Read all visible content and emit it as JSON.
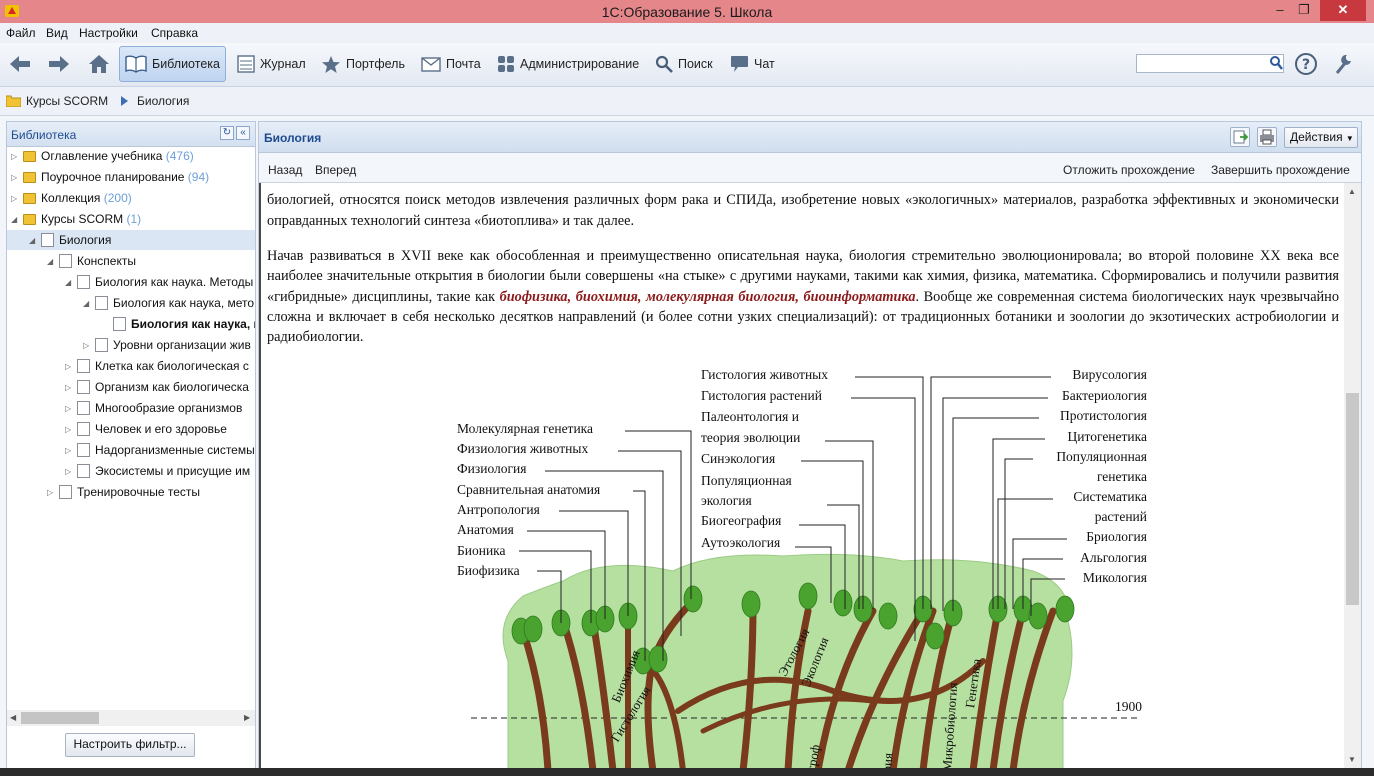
{
  "window": {
    "title": "1С:Образование 5. Школа"
  },
  "menu": [
    "Файл",
    "Вид",
    "Настройки",
    "Справка"
  ],
  "toolbar": {
    "library": "Библиотека",
    "journal": "Журнал",
    "portfolio": "Портфель",
    "mail": "Почта",
    "admin": "Администрирование",
    "search": "Поиск",
    "chat": "Чат",
    "search_value": ""
  },
  "breadcrumb": {
    "root": "Курсы SCORM",
    "current": "Биология"
  },
  "library_panel": {
    "title": "Библиотека",
    "tree": [
      {
        "label": "Оглавление учебника",
        "count": "(476)"
      },
      {
        "label": "Поурочное планирование",
        "count": "(94)"
      },
      {
        "label": "Коллекция",
        "count": "(200)"
      },
      {
        "label": "Курсы SCORM",
        "count": "(1)"
      },
      {
        "label": "Биология",
        "count": ""
      },
      {
        "label": "Конспекты",
        "count": ""
      },
      {
        "label": "Биология как наука. Методы",
        "count": ""
      },
      {
        "label": "Биология как наука, мето",
        "count": ""
      },
      {
        "label": "Биология как наука, м",
        "count": ""
      },
      {
        "label": "Уровни организации жив",
        "count": ""
      },
      {
        "label": "Клетка как биологическая с",
        "count": ""
      },
      {
        "label": "Организм как биологическа",
        "count": ""
      },
      {
        "label": "Многообразие организмов",
        "count": ""
      },
      {
        "label": "Человек и его здоровье",
        "count": ""
      },
      {
        "label": "Надорганизменные системы",
        "count": ""
      },
      {
        "label": "Экосистемы и присущие им",
        "count": ""
      },
      {
        "label": "Тренировочные тесты",
        "count": ""
      }
    ],
    "filter_button": "Настроить фильтр..."
  },
  "content_panel": {
    "title": "Биология",
    "actions": "Действия",
    "nav_back": "Назад",
    "nav_forward": "Вперед",
    "postpone": "Отложить прохождение",
    "finish": "Завершить прохождение"
  },
  "article": {
    "p1_line2": "биологией, относятся поиск методов извлечения различных форм рака и СПИДа, изобретение новых «экологичных» материалов, разработка эффективных и экономически оправданных технологий синтеза «биотоплива» и так далее.",
    "p2_a": "Начав развиваться в XVII веке как обособленная и преимущественно описательная наука, биология стремительно эволюционировала; во второй половине XX века все наиболее значительные открытия в биологии были совершены «на стыке» с другими науками, такими как химия, физика, математика. Сформировались и получили развития «гибридные» дисциплины, такие как ",
    "t1": "биофизика",
    "sep": ", ",
    "t2": "биохимия",
    "t3": "молекулярная биология",
    "t4": "биоинформатика",
    "p2_b": ". Вообще же современная система биологических наук чрезвычайно сложна и включает в себя несколько десятков направлений (и более сотни узких специализаций): от традиционных ботаники и зоологии до экзотических астробиологии и радиобиологии."
  },
  "figure": {
    "left_labels": [
      "Молекулярная генетика",
      "Физиология животных",
      "Физиология",
      "Сравнительная анатомия",
      "Антропология",
      "Анатомия",
      "Бионика",
      "Биофизика"
    ],
    "mid_labels": [
      "Гистология животных",
      "Гистология растений",
      "Палеонтология и",
      "теория эволюции",
      "Синэкология",
      "Популяционная",
      "экология",
      "Биогеография",
      "Аутоэкология"
    ],
    "right_labels": [
      "Вирусология",
      "Бактериология",
      "Протистология",
      "Цитогенетика",
      "Популяционная",
      "генетика",
      "Систематика",
      "растений",
      "Бриология",
      "Альгология",
      "Микология"
    ],
    "trunk_labels": [
      "Биохимия",
      "Гистология",
      "Этология",
      "Экология",
      "Микробиология",
      "Генетика",
      "троф",
      "рия"
    ],
    "year": "1900"
  },
  "colors": {
    "titlebar": "#e5878a",
    "close": "#c7383f",
    "accent": "#1d4b8f",
    "term": "#8d1a1a",
    "tree_green": "#b6e0a0",
    "trunk": "#7a3a1c",
    "leaf": "#4aa32f"
  }
}
